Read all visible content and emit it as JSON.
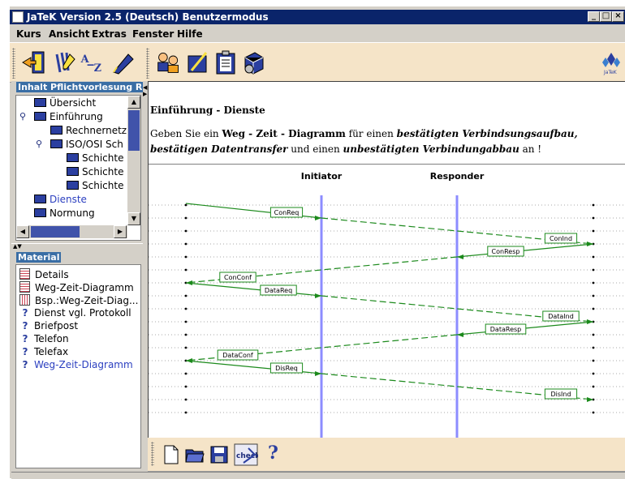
{
  "window": {
    "title": "JaTeK Version 2.5 (Deutsch) Benutzermodus"
  },
  "menu": {
    "kurs": "Kurs",
    "ansicht": "Ansicht",
    "extras": "Extras",
    "fenster": "Fenster",
    "hilfe": "Hilfe"
  },
  "brand": {
    "logo_text": "JaTeK"
  },
  "tree": {
    "title": "Inhalt Pflichtvorlesung Re",
    "items": [
      "Übersicht",
      "Einführung",
      "Rechnernetz",
      "ISO/OSI Sch",
      "Schichte",
      "Schichte",
      "Schichte",
      "Dienste",
      "Normung"
    ]
  },
  "material": {
    "title": "Material",
    "items": [
      "Details",
      "Weg-Zeit-Diagramm",
      "Bsp.:Weg-Zeit-Diag...",
      "Dienst vgl. Protokoll",
      "Briefpost",
      "Telefon",
      "Telefax",
      "Weg-Zeit-Diagramm"
    ]
  },
  "content": {
    "title": "Einführung - Dienste",
    "text": {
      "p1": "Geben Sie ein ",
      "p2": "Weg - Zeit - Diagramm",
      "p3": " für einen ",
      "p4": "bestätigten Verbindsungsaufbau, bestätigen Datentransfer",
      "p5": " und einen ",
      "p6": "unbestätigten Verbindungabbau",
      "p7": " an !"
    }
  },
  "chart_data": {
    "type": "diagram",
    "columns": [
      "Initiator",
      "Responder"
    ],
    "messages": [
      {
        "label": "ConReq",
        "from": "left",
        "to": "right"
      },
      {
        "label": "ConInd",
        "from": "left",
        "to": "right"
      },
      {
        "label": "ConResp",
        "from": "right",
        "to": "left"
      },
      {
        "label": "ConConf",
        "from": "right",
        "to": "left"
      },
      {
        "label": "DataReq",
        "from": "left",
        "to": "right"
      },
      {
        "label": "DataInd",
        "from": "left",
        "to": "right"
      },
      {
        "label": "DataResp",
        "from": "right",
        "to": "left"
      },
      {
        "label": "DataConf",
        "from": "right",
        "to": "left"
      },
      {
        "label": "DisReq",
        "from": "left",
        "to": "right"
      },
      {
        "label": "DisInd",
        "from": "left",
        "to": "right"
      }
    ],
    "line_color": "#1c8a1c",
    "column_color": "#8c8cff"
  },
  "bottom_toolbar": {
    "check_label": "check",
    "help_glyph": "?"
  }
}
